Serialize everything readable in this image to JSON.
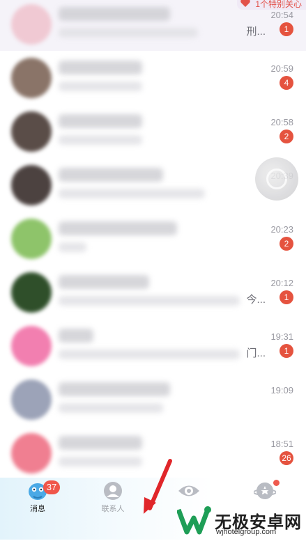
{
  "top_banner": {
    "label": "1个特别关心"
  },
  "conversations": [
    {
      "time": "20:54",
      "snippet": "刑...",
      "badge": "1",
      "avatar_color": "#f0c9d3",
      "name_w": 160,
      "msg_w": 200
    },
    {
      "time": "20:59",
      "snippet": "",
      "badge": "4",
      "avatar_color": "#8a7468",
      "name_w": 120,
      "msg_w": 120
    },
    {
      "time": "20:58",
      "snippet": "",
      "badge": "2",
      "avatar_color": "#5a4d48",
      "name_w": 120,
      "msg_w": 120
    },
    {
      "time": "20:39",
      "snippet": "",
      "badge": "",
      "avatar_color": "#4c4240",
      "name_w": 150,
      "msg_w": 210
    },
    {
      "time": "20:23",
      "snippet": "",
      "badge": "2",
      "avatar_color": "#8ec46a",
      "name_w": 170,
      "msg_w": 40
    },
    {
      "time": "20:12",
      "snippet": "今...",
      "badge": "1",
      "avatar_color": "#2f4f2a",
      "name_w": 130,
      "msg_w": 260
    },
    {
      "time": "19:31",
      "snippet": "门...",
      "badge": "1",
      "avatar_color": "#f27fb0",
      "name_w": 50,
      "msg_w": 260
    },
    {
      "time": "19:09",
      "snippet": "",
      "badge": "",
      "avatar_color": "#9ca3b8",
      "name_w": 160,
      "msg_w": 150
    },
    {
      "time": "18:51",
      "snippet": "",
      "badge": "26",
      "avatar_color": "#f07f91",
      "name_w": 120,
      "msg_w": 120
    }
  ],
  "tabs": {
    "messages": {
      "label": "消息",
      "badge": "37"
    },
    "contacts": {
      "label": "联系人"
    },
    "watch": {
      "label": ""
    },
    "moments": {
      "label": ""
    }
  },
  "watermark": {
    "name": "无极安卓网",
    "url": "wjhotelgroup.com"
  },
  "colors": {
    "badge": "#e5533f",
    "accent_blue": "#3aa6e8",
    "pinned_bg": "#f5f3f9"
  }
}
